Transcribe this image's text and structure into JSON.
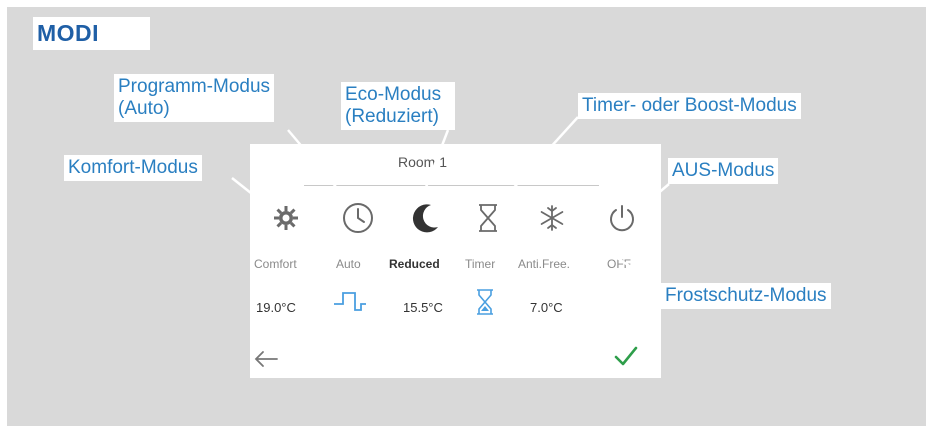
{
  "heading": "MODI",
  "screen": {
    "room_title": "Room 1",
    "modes": [
      {
        "key": "comfort",
        "icon": "sun-gear-icon",
        "label": "Comfort",
        "temp": "19.0°C"
      },
      {
        "key": "auto",
        "icon": "clock-icon",
        "label": "Auto",
        "temp": ""
      },
      {
        "key": "reduced",
        "icon": "moon-icon",
        "label": "Reduced",
        "temp": "15.5°C"
      },
      {
        "key": "timer",
        "icon": "hourglass-icon",
        "label": "Timer",
        "temp": ""
      },
      {
        "key": "antifreeze",
        "icon": "snowflake-icon",
        "label": "Anti.Free.",
        "temp": "7.0°C"
      },
      {
        "key": "off",
        "icon": "power-icon",
        "label": "OFF",
        "temp": ""
      }
    ],
    "back_icon": "back-arrow-icon",
    "confirm_icon": "checkmark-icon"
  },
  "callouts": {
    "komfort": "Komfort-Modus",
    "programm_line1": "Programm-Modus",
    "programm_line2": "(Auto)",
    "eco_line1": "Eco-Modus",
    "eco_line2": "(Reduziert)",
    "timer": "Timer- oder Boost-Modus",
    "aus": "AUS-Modus",
    "frost": "Frostschutz-Modus"
  },
  "colors": {
    "heading": "#1f5fa6",
    "callout_text": "#2a7fc1",
    "panel_bg": "#d9d9d9",
    "timer_icon": "#4a9fe0",
    "check": "#2e9e4a"
  }
}
